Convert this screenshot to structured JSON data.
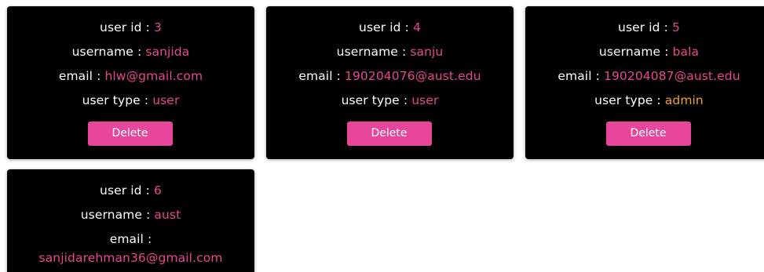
{
  "labels": {
    "user_id": "user id : ",
    "username": "username : ",
    "email": "email : ",
    "email_wrapped": "email :",
    "user_type": "user type : ",
    "delete_button": "Delete"
  },
  "colors": {
    "card_bg": "#000000",
    "value_pink": "#e8468f",
    "value_admin": "#f2a01c",
    "button_bg": "#e8469a"
  },
  "users": [
    {
      "id": "3",
      "username": "sanjida",
      "email": "hlw@gmail.com",
      "user_type": "user"
    },
    {
      "id": "4",
      "username": "sanju",
      "email": "190204076@aust.edu",
      "user_type": "user"
    },
    {
      "id": "5",
      "username": "bala",
      "email": "190204087@aust.edu",
      "user_type": "admin"
    },
    {
      "id": "6",
      "username": "aust",
      "email": "sanjidarehman36@gmail.com"
    }
  ]
}
